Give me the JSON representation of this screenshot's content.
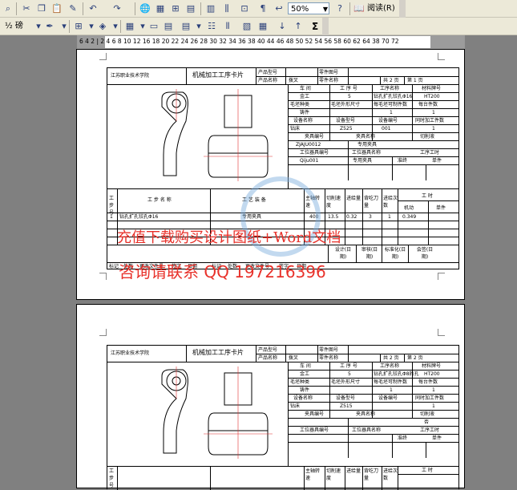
{
  "toolbar1": {
    "zoom_value": "50%",
    "read_label": "阅读(R)"
  },
  "toolbar2": {
    "font_label": "½ 磅",
    "sigma": "Σ"
  },
  "ruler": {
    "ticks": "6  4  2  |  2  4  6  8  10  12  16  18  20  22  24  26  28  30  32  34  36  38  40  44  46  48  50  52  54  56  58  60  62  64     38 70 72"
  },
  "page1": {
    "school": "江苏职业技术学院",
    "title": "机械加工工序卡片",
    "product_model_label": "产品型号",
    "part_figure_label": "零件图号",
    "product_name_label": "产品名称",
    "product_name": "拨叉",
    "part_name_label": "零件名称",
    "total_pages": "共 2 页",
    "page_no": "第 1 页",
    "workshop_label": "车 间",
    "process_no_label": "工 序 号",
    "process_name_label": "工序名称",
    "material_label": "材料牌号",
    "workshop": "金工",
    "process_no": "5",
    "process_name": "钻孔扩孔铰孔Φ16",
    "material": "HT200",
    "blank_type_label": "毛坯种类",
    "blank_size_label": "毛坯外形尺寸",
    "blank_count_label": "每毛坯可制件数",
    "per_machine_label": "每台件数",
    "blank_type": "铸件",
    "blank_count": "1",
    "per_machine": "1",
    "equip_name_label": "设备名称",
    "equip_model_label": "设备型号",
    "equip_no_label": "设备编号",
    "simul_label": "同时加工件数",
    "equip_name": "钻床",
    "equip_model": "Z525",
    "equip_no": "001",
    "simul": "1",
    "fixture_no_label": "夹具编号",
    "fixture_name_label": "夹具名称",
    "coolant_label": "切削液",
    "fixture_no": "ZJAJU0012",
    "fixture_name": "专用夹具",
    "tool_no_label": "工位器具编号",
    "tool_name_label": "工位器具名称",
    "hours_label": "工序工时",
    "tool_no": "Qiju001",
    "tool_name": "专用夹具",
    "prep_label": "准终",
    "unit_label": "单件",
    "step_no_label": "工步号",
    "step_content_label": "工 步 名 称",
    "step_equip_label": "工 艺 装 备",
    "spindle_label": "主轴转速",
    "cut_speed_label": "切削速度",
    "feed_label": "进给量",
    "depth_label": "背吃刀量",
    "passes_label": "进给次数",
    "time_label": "工 时",
    "machine_time_label": "机动",
    "aux_time_label": "单件",
    "step1_no": "1",
    "step1_content": "钻孔扩孔铰孔Φ16",
    "step1_equip": "专用夹具",
    "step1_spindle": "400",
    "step1_speed": "13.5",
    "step1_feed": "0.32",
    "step1_depth": "3",
    "step1_passes": "1",
    "step1_time": "0.349",
    "design_label": "设计(日期)",
    "check_label": "审核(日期)",
    "standard_label": "标准化(日期)",
    "sign_label": "会签(日期)",
    "mark_label": "标记",
    "count_label": "处数",
    "change_label": "更改文件号",
    "signature_label": "签字",
    "date_label": "日期"
  },
  "page2": {
    "school": "江苏职业技术学院",
    "title": "机械加工工序卡片",
    "product_name": "拨叉",
    "total_pages": "共 2 页",
    "page_no": "第 2 页",
    "workshop": "金工",
    "process_no": "5",
    "process_name": "钻孔扩孔铰孔Φ8的孔",
    "material": "HT200",
    "blank_type": "铸件",
    "blank_count": "1",
    "per_machine": "1",
    "equip_name": "钻床",
    "equip_model": "Z515",
    "simul": "1",
    "coolant": "否"
  },
  "watermark": {
    "line1": "充值下载购买设计图纸+Word文档",
    "line2": "咨询请联系 QQ 197216396"
  }
}
